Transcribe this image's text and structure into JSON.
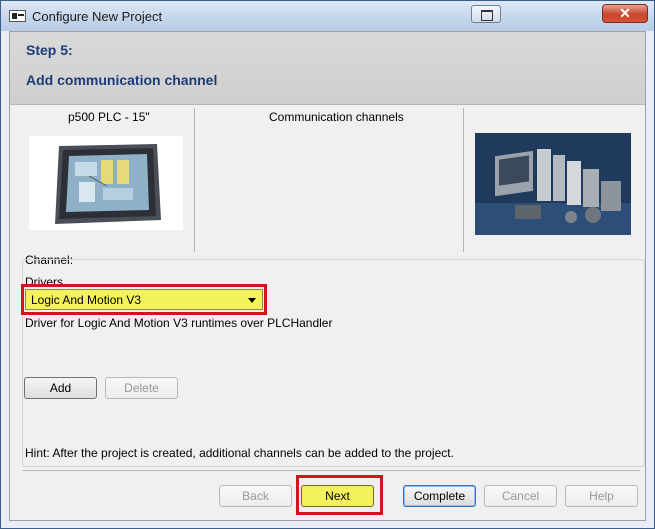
{
  "window": {
    "title": "Configure New Project"
  },
  "header": {
    "step": "Step 5:",
    "subtitle": "Add communication channel"
  },
  "device": {
    "label": "p500 PLC - 15\""
  },
  "channels": {
    "heading": "Communication channels"
  },
  "channel_section": {
    "label": "Channel:",
    "drivers_label": "Drivers",
    "selected_driver": "Logic And Motion V3",
    "description": "Driver for Logic And Motion V3 runtimes over PLCHandler",
    "add_label": "Add",
    "delete_label": "Delete"
  },
  "hint": "Hint: After the project is created, additional channels can be added to the project.",
  "footer": {
    "back_label": "Back",
    "next_label": "Next",
    "complete_label": "Complete",
    "cancel_label": "Cancel",
    "help_label": "Help"
  },
  "colors": {
    "highlight": "#f4f25c",
    "annotation": "#d4141c",
    "title_text": "#1d3a7a"
  }
}
